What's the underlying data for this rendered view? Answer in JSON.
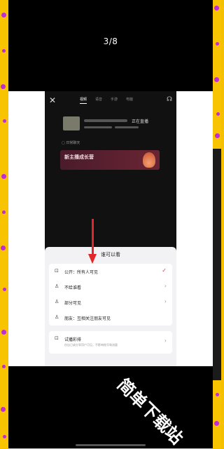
{
  "viewer": {
    "counter": "3/8"
  },
  "phone": {
    "tabs": [
      "视频",
      "语音",
      "手游",
      "电脑"
    ],
    "active_tab": "视频",
    "edit_text": "正在直播",
    "chat_label": "日常聊天",
    "banner": {
      "title": "新主播成长营",
      "subtitle": ""
    }
  },
  "sheet": {
    "title": "谁可以看",
    "options": [
      {
        "icon": "lock-icon",
        "label": "公开：所有人可见",
        "right": "✓"
      },
      {
        "icon": "user-block-icon",
        "label": "不给谁看",
        "right": "›"
      },
      {
        "icon": "user-partial-icon",
        "label": "部分可见",
        "right": "›"
      },
      {
        "icon": "friends-icon",
        "label": "朋友：互相关注朋友可见",
        "right": ""
      }
    ],
    "trial": {
      "label": "试播彩排",
      "subtitle": "仅自己或分享用户可见，不影响账号和流量",
      "right": "›"
    }
  },
  "watermark": "简单下载站",
  "colors": {
    "accent_red": "#e3262b",
    "check_red": "#e8344d",
    "yellow": "#f8c400",
    "dots": "#c02ad8"
  }
}
